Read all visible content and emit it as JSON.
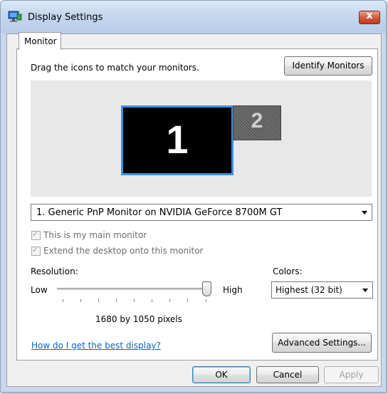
{
  "window": {
    "title": "Display Settings",
    "close_glyph": "x"
  },
  "tabs": [
    {
      "label": "Monitor"
    }
  ],
  "monitor_panel": {
    "instruction": "Drag the icons to match your monitors.",
    "identify_button": "Identify Monitors",
    "monitors": [
      {
        "number": "1",
        "selected": true
      },
      {
        "number": "2",
        "selected": false
      }
    ],
    "monitor_select": "1. Generic PnP Monitor on NVIDIA GeForce 8700M GT",
    "checkbox_main": {
      "label": "This is my main monitor",
      "checked": true,
      "enabled": false
    },
    "checkbox_extend": {
      "label": "Extend the desktop onto this monitor",
      "checked": true,
      "enabled": false
    },
    "resolution": {
      "label": "Resolution:",
      "low": "Low",
      "high": "High",
      "value_text": "1680 by 1050 pixels",
      "slider_level": 1.0
    },
    "colors": {
      "label": "Colors:",
      "value": "Highest (32 bit)"
    },
    "help_link": "How do I get the best display?",
    "advanced_button": "Advanced Settings..."
  },
  "footer": {
    "ok": "OK",
    "cancel": "Cancel",
    "apply": "Apply"
  },
  "colors_theme": {
    "selected_border": "#3d8ee0",
    "link": "#0066cc",
    "close": "#c0381d"
  }
}
